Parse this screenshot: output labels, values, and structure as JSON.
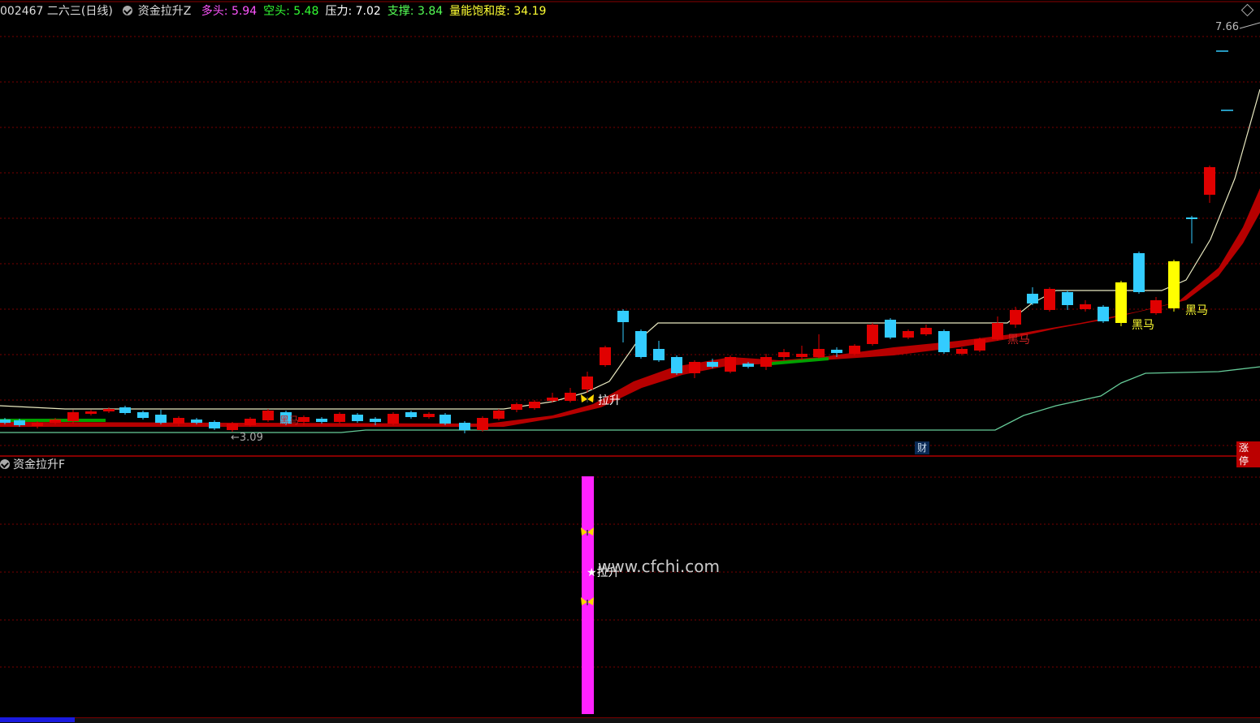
{
  "header": {
    "stock": "002467 二六三(日线)",
    "indicator": "资金拉升Z",
    "items": [
      {
        "label": "多头",
        "value": "5.94",
        "color": "#ff55ff"
      },
      {
        "label": "空头",
        "value": "5.48",
        "color": "#33ff33"
      },
      {
        "label": "压力",
        "value": "7.02",
        "color": "#ffffff"
      },
      {
        "label": "支撑",
        "value": "3.84",
        "color": "#55ff55"
      },
      {
        "label": "量能饱和度",
        "value": "34.19",
        "color": "#ffff33"
      }
    ]
  },
  "price_labels": {
    "high": "7.66",
    "low": "←3.09"
  },
  "signals": {
    "lift": "拉升",
    "dark_horse": "黑马",
    "lift_star": "★拉升"
  },
  "badges": {
    "cai": "财",
    "zhangting": "涨停"
  },
  "sub_panel": {
    "title": "资金拉升F"
  },
  "watermark": "www.cfchi.com",
  "colors": {
    "up": "#e00000",
    "down": "#33ccff",
    "ribbon_up": "#c00000",
    "ribbon_down": "#00a000",
    "ma_line": "#e8e8c0",
    "support_line": "#66cc99",
    "grid": "#7a0000",
    "yellow": "#ffff00",
    "magenta": "#ff22ff"
  }
}
